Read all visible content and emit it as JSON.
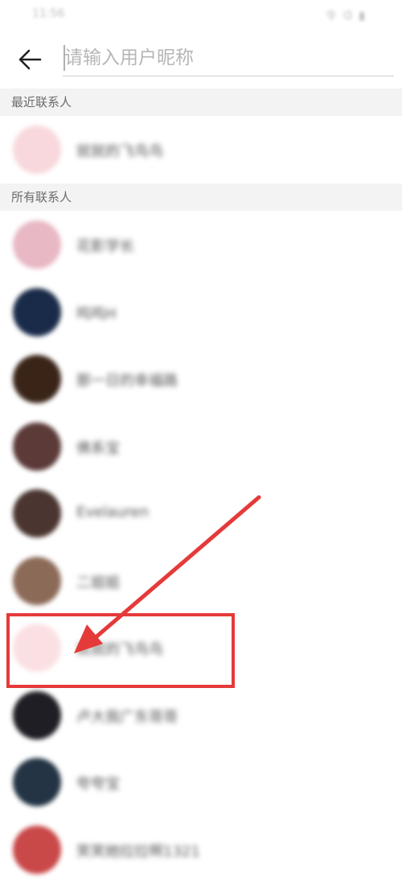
{
  "status_bar": {
    "time": "11:56",
    "icons": "令 Ɑ ▮"
  },
  "search": {
    "placeholder": "请输入用户昵称",
    "value": ""
  },
  "sections": {
    "recent_label": "最近联系人",
    "all_label": "所有联系人"
  },
  "recent_contacts": [
    {
      "name": "就就的飞鸟鸟",
      "avatar_color": "#f8d8dc"
    }
  ],
  "all_contacts": [
    {
      "name": "花影学长",
      "avatar_color": "#e8b8c4"
    },
    {
      "name": "鸣鸣H",
      "avatar_color": "#1a2b4a"
    },
    {
      "name": "那一日的幸福路",
      "avatar_color": "#3a2418"
    },
    {
      "name": "佛系宝",
      "avatar_color": "#5b3a38"
    },
    {
      "name": "Evelauren",
      "avatar_color": "#4a3530"
    },
    {
      "name": "二姐姐",
      "avatar_color": "#8c6a58"
    },
    {
      "name": "就就的飞鸟鸟",
      "avatar_color": "#fbe0e3"
    },
    {
      "name": "卢大我广东哥哥",
      "avatar_color": "#1e1e24"
    },
    {
      "name": "夸夸宝",
      "avatar_color": "#243444"
    },
    {
      "name": "笑笑她拉拉啊1321",
      "avatar_color": "#c94848"
    }
  ],
  "annotation": {
    "color": "#e53a3a"
  }
}
